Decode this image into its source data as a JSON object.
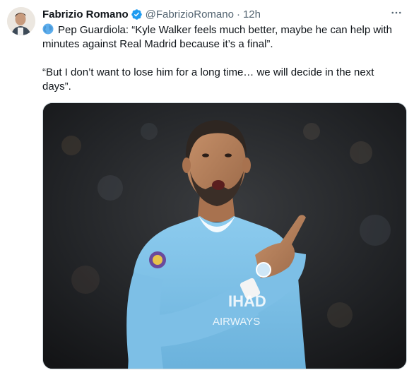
{
  "tweet": {
    "author_name": "Fabrizio Romano",
    "handle": "@FabrizioRomano",
    "separator": "·",
    "time": "12h",
    "more_icon": "more-horizontal-icon",
    "verified_icon": "verified-badge-icon",
    "paragraph_1": "Pep Guardiola: “Kyle Walker feels much better, maybe he can help with minutes against Real Madrid because it’s a final”.",
    "paragraph_2": "“But I don’t want to lose him for a long time… we will decide in the next days”.",
    "leading_icon": "globe-emoji-icon",
    "photo": {
      "shirt_sponsor_text": "etihad airways"
    }
  },
  "colors": {
    "accent": "#1d9bf0",
    "secondary_text": "#536471",
    "primary_text": "#0f1419",
    "shirt_sky_blue": "#7fc2ea"
  }
}
